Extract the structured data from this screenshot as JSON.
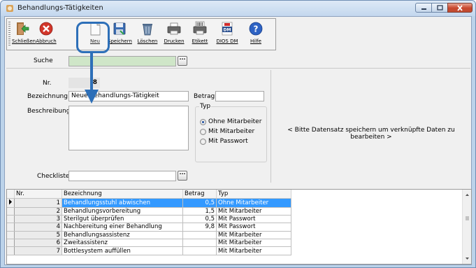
{
  "window": {
    "title": "Behandlungs-Tätigkeiten"
  },
  "toolbar": {
    "buttons": [
      {
        "label": "Schließen",
        "icon": "green-arrow-exit-icon"
      },
      {
        "label": "Abbruch",
        "icon": "red-cancel-icon"
      },
      {
        "label": "Neu",
        "icon": "new-document-icon"
      },
      {
        "label": "Speichern",
        "icon": "save-disk-icon"
      },
      {
        "label": "Löschen",
        "icon": "trash-bin-icon"
      },
      {
        "label": "Drucken",
        "icon": "printer-icon"
      },
      {
        "label": "Etikett",
        "icon": "label-printer-icon"
      },
      {
        "label": "DIOS DM",
        "icon": "dios-pdf-icon"
      },
      {
        "label": "Hilfe",
        "icon": "help-icon"
      }
    ]
  },
  "search": {
    "label": "Suche",
    "value": ""
  },
  "form": {
    "nr_label": "Nr.",
    "nr_value": "8",
    "bezeichnung_label": "Bezeichnung",
    "bezeichnung_value": "Neue Behandlungs-Tätigkeit",
    "betrag_label": "Betrag",
    "betrag_value": "",
    "beschreibung_label": "Beschreibung",
    "beschreibung_value": "",
    "typ_label": "Typ",
    "typ_options": [
      "Ohne Mitarbeiter",
      "Mit Mitarbeiter",
      "Mit Passwort"
    ],
    "typ_selected": "Ohne Mitarbeiter",
    "checkliste_label": "Checkliste",
    "checkliste_value": ""
  },
  "linked_message": "< Bitte Datensatz speichern um verknüpfte Daten zu bearbeiten >",
  "table": {
    "columns": [
      "Nr.",
      "Bezeichnung",
      "Betrag",
      "Typ"
    ],
    "rows": [
      {
        "nr": "1",
        "bezeichnung": "Behandlungsstuhl abwischen",
        "betrag": "0,5",
        "typ": "Ohne Mitarbeiter"
      },
      {
        "nr": "2",
        "bezeichnung": "Behandlungsvorbereitung",
        "betrag": "1,5",
        "typ": "Mit Mitarbeiter"
      },
      {
        "nr": "3",
        "bezeichnung": "Sterilgut überprüfen",
        "betrag": "0,5",
        "typ": "Mit Passwort"
      },
      {
        "nr": "4",
        "bezeichnung": "Nachbereitung einer Behandlung",
        "betrag": "9,8",
        "typ": "Mit Passwort"
      },
      {
        "nr": "5",
        "bezeichnung": "Behandlungsassistenz",
        "betrag": "",
        "typ": "Mit Mitarbeiter"
      },
      {
        "nr": "6",
        "bezeichnung": "Zweitassistenz",
        "betrag": "",
        "typ": "Mit Mitarbeiter"
      },
      {
        "nr": "7",
        "bezeichnung": "Bottlesystem auffüllen",
        "betrag": "",
        "typ": "Mit Mitarbeiter"
      }
    ],
    "selected_row": 0
  },
  "colors": {
    "selection": "#3399ff",
    "search_field": "#cfe6c8",
    "highlight": "#2d6fb8"
  }
}
